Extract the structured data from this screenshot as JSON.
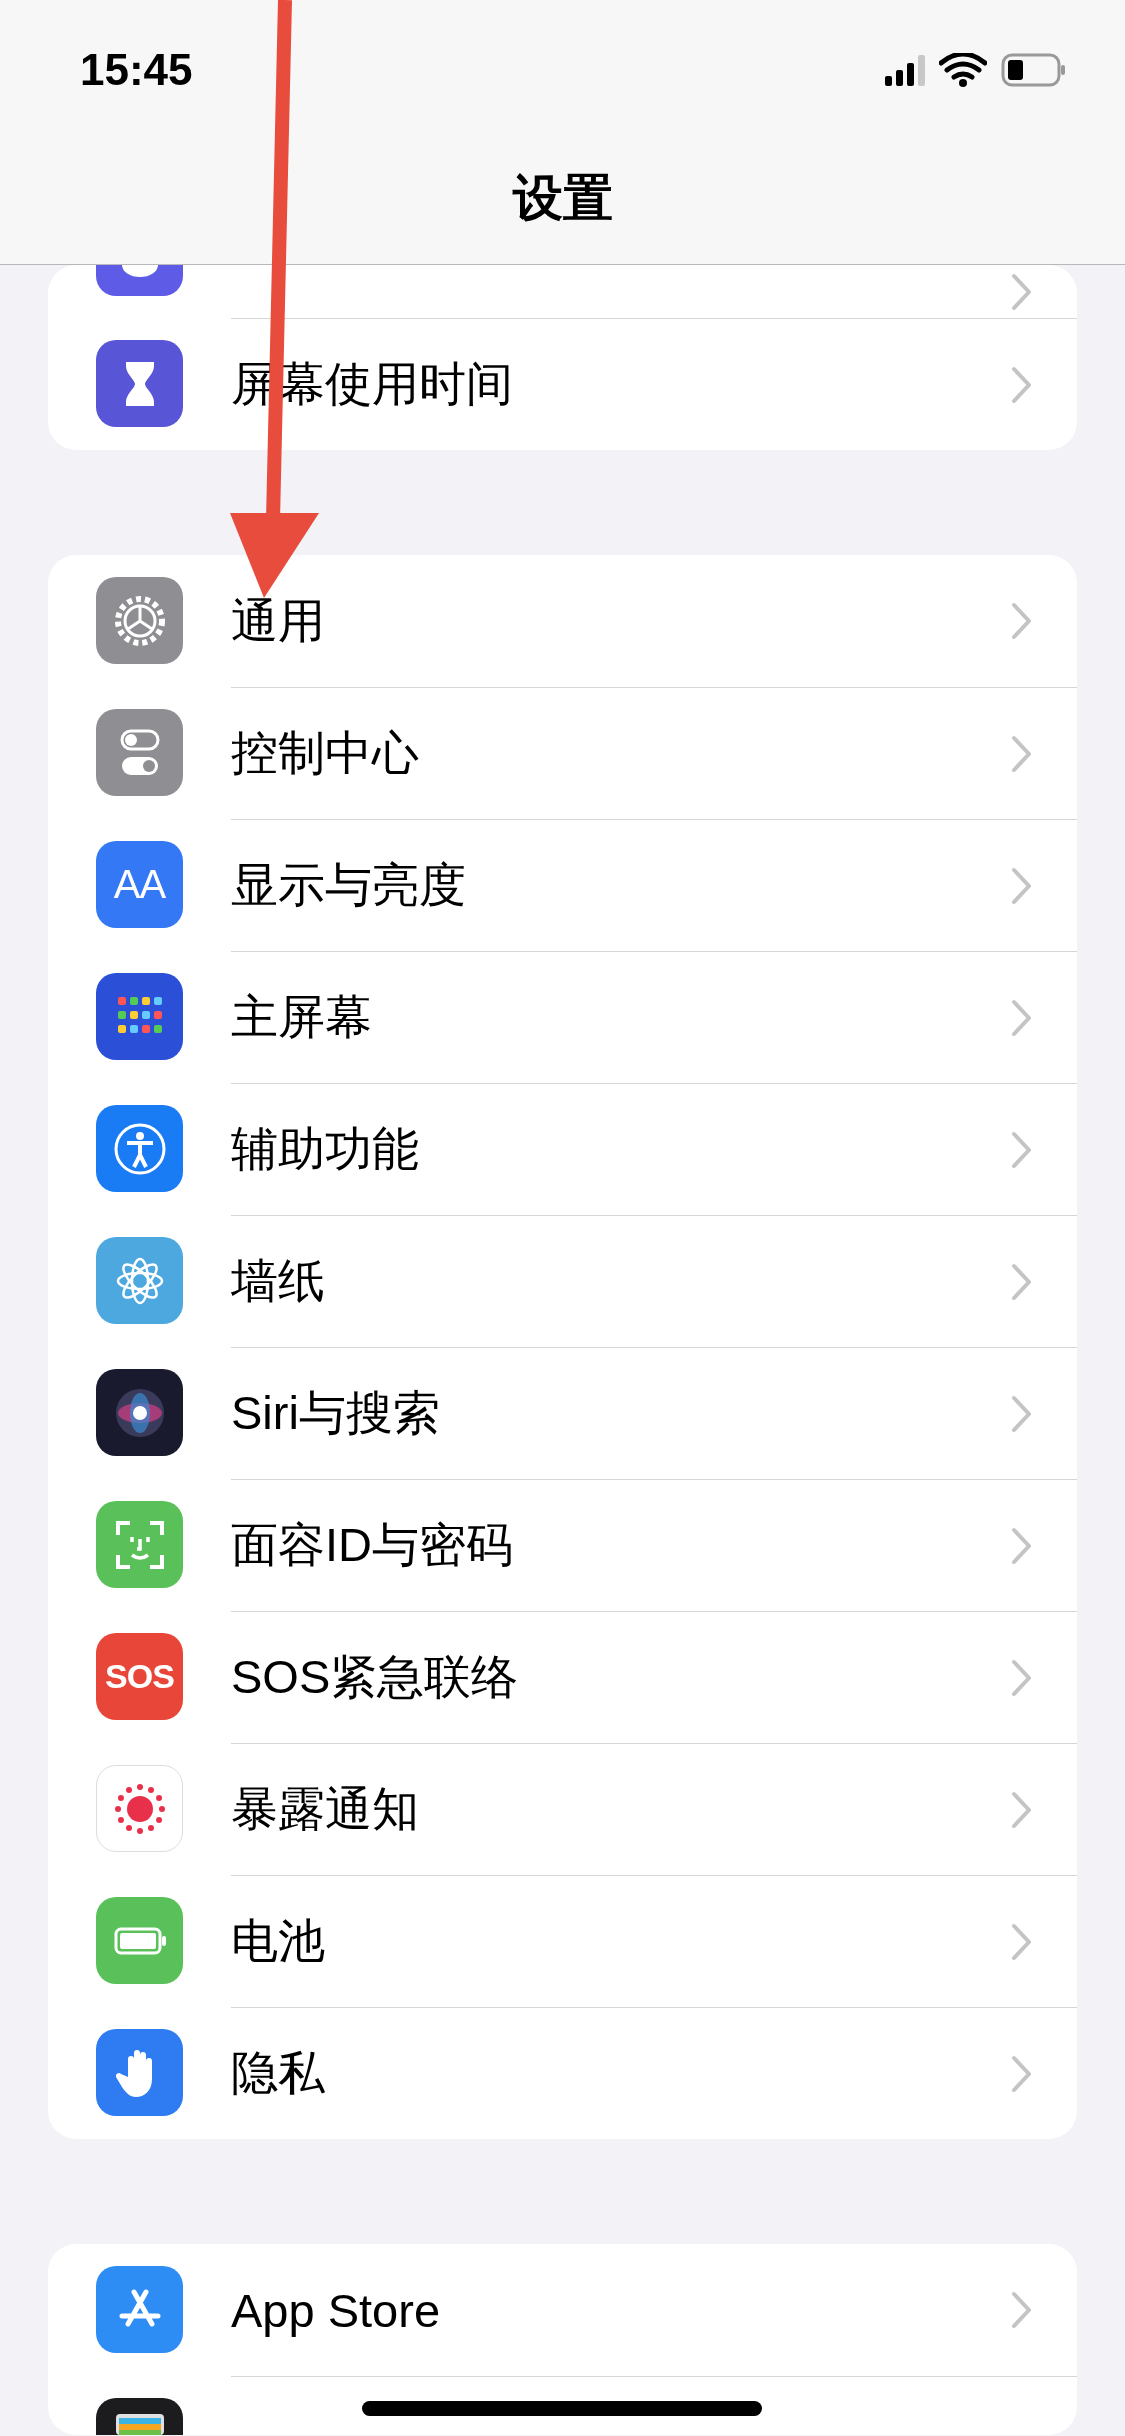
{
  "status_bar": {
    "time": "15:45"
  },
  "nav": {
    "title": "设置"
  },
  "groups": [
    {
      "rows": [
        {
          "kind": "moon"
        },
        {
          "kind": "hourglass",
          "label": "屏幕使用时间"
        }
      ]
    },
    {
      "rows": [
        {
          "kind": "gear",
          "label": "通用"
        },
        {
          "kind": "switches",
          "label": "控制中心"
        },
        {
          "kind": "text-size",
          "icon_text": "AA",
          "label": "显示与亮度"
        },
        {
          "kind": "home-grid",
          "label": "主屏幕"
        },
        {
          "kind": "accessibility",
          "label": "辅助功能"
        },
        {
          "kind": "flower",
          "label": "墙纸"
        },
        {
          "kind": "siri",
          "label": "Siri与搜索"
        },
        {
          "kind": "face-id",
          "label": "面容ID与密码"
        },
        {
          "kind": "sos",
          "icon_text": "SOS",
          "label": "SOS紧急联络"
        },
        {
          "kind": "exposure",
          "label": "暴露通知"
        },
        {
          "kind": "battery",
          "label": "电池"
        },
        {
          "kind": "hand",
          "label": "隐私"
        }
      ]
    },
    {
      "rows": [
        {
          "kind": "app-store",
          "label": "App Store"
        },
        {
          "kind": "wallet"
        }
      ]
    }
  ]
}
